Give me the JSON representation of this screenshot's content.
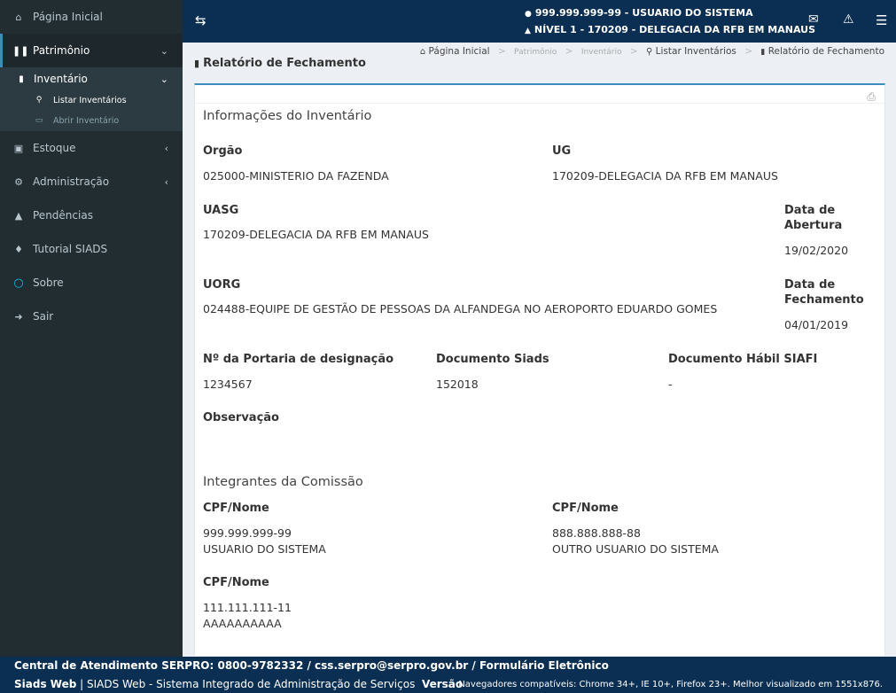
{
  "sidebar": {
    "items": [
      {
        "label": "Página Inicial",
        "icon": "home-icon"
      },
      {
        "label": "Patrimônio",
        "icon": "barcode-icon"
      },
      {
        "label": "Estoque",
        "icon": "archive-icon"
      },
      {
        "label": "Administração",
        "icon": "cogs-icon"
      },
      {
        "label": "Pendências",
        "icon": "warning-icon"
      },
      {
        "label": "Tutorial SIADS",
        "icon": "graduation-cap-icon"
      },
      {
        "label": "Sobre",
        "icon": "circle-icon"
      },
      {
        "label": "Sair",
        "icon": "sign-in-icon"
      }
    ],
    "submenu": {
      "inventario": "Inventário",
      "listar": "Listar Inventários",
      "abrir": "Abrir Inventário"
    }
  },
  "header": {
    "user_cpf": "999.999.999-99 - USUARIO DO SISTEMA",
    "user_level": "NÍVEL 1 - 170209 - DELEGACIA DA RFB EM MANAUS"
  },
  "page": {
    "title": "Relatório de Fechamento",
    "breadcrumb": [
      "Página Inicial",
      "Patrimônio",
      "Inventário",
      "Listar Inventários",
      "Relatório de Fechamento"
    ]
  },
  "inventario": {
    "section_title": "Informações do Inventário",
    "orgao_label": "Orgão",
    "orgao_value": "025000-MINISTERIO DA FAZENDA",
    "ug_label": "UG",
    "ug_value": "170209-DELEGACIA DA RFB EM MANAUS",
    "uasg_label": "UASG",
    "uasg_value": "170209-DELEGACIA DA RFB EM MANAUS",
    "data_abertura_label_1": "Data de",
    "data_abertura_label_2": "Abertura",
    "data_abertura_value": "19/02/2020",
    "uorg_label": "UORG",
    "uorg_value": "024488-EQUIPE DE GESTÃO DE PESSOAS DA ALFANDEGA NO AEROPORTO EDUARDO GOMES",
    "data_fechamento_label_1": "Data de",
    "data_fechamento_label_2": "Fechamento",
    "data_fechamento_value": "04/01/2019",
    "portaria_label": "Nº da Portaria de designação",
    "portaria_value": "1234567",
    "doc_siads_label": "Documento Siads",
    "doc_siads_value": "152018",
    "doc_habil_label": "Documento Hábil SIAFI",
    "doc_habil_value": "-",
    "observacao_label": "Observação"
  },
  "comissao": {
    "section_title": "Integrantes da Comissão",
    "members": [
      {
        "label": "CPF/Nome",
        "cpf": "999.999.999-99",
        "nome": "USUARIO DO SISTEMA"
      },
      {
        "label": "CPF/Nome",
        "cpf": "888.888.888-88",
        "nome": "OUTRO USUARIO DO SISTEMA"
      },
      {
        "label": "CPF/Nome",
        "cpf": "111.111.111-11",
        "nome": "AAAAAAAAAA"
      }
    ]
  },
  "footer": {
    "line1": "Central de Atendimento SERPRO: 0800-9782332 / css.serpro@serpro.gov.br / Formulário Eletrônico",
    "app_name": "Siads Web",
    "app_desc": " | SIADS Web - Sistema Integrado de Administração de Serviços",
    "version_label": "Versão",
    "compat": "Navegadores compatíveis: Chrome 34+, IE 10+, Firefox 23+. Melhor visualizado em 1551x876."
  }
}
